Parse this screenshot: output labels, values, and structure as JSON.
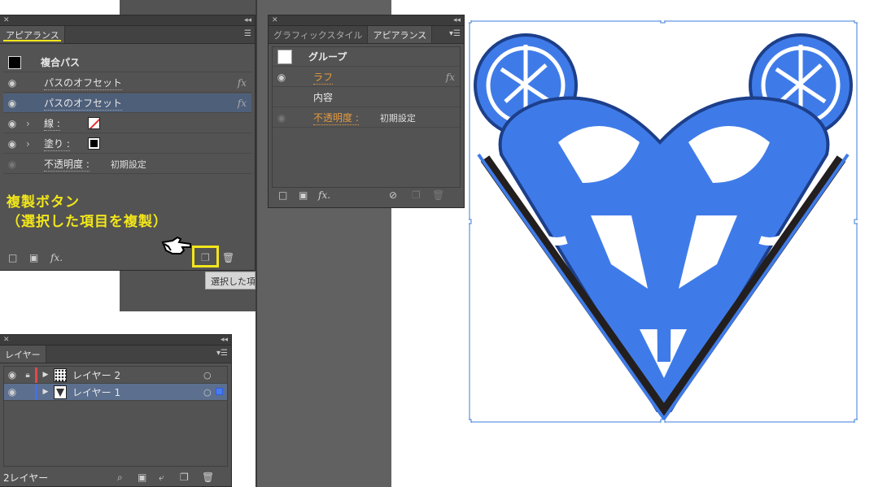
{
  "appearance_left": {
    "tab": "アピアランス",
    "header_title": "複合パス",
    "rows": [
      {
        "label": "パスのオフセット",
        "fx": "fx"
      },
      {
        "label": "パスのオフセット",
        "fx": "fx"
      },
      {
        "label": "線 :"
      },
      {
        "label": "塗り :"
      },
      {
        "label": "不透明度 :",
        "value": "初期設定"
      }
    ],
    "footer_fx": "fx."
  },
  "annotation": {
    "line1": "複製ボタン",
    "line2": "（選択した項目を複製）"
  },
  "tooltip": "選択した項",
  "appearance_right": {
    "tabs": [
      "グラフィックスタイル",
      "アピアランス"
    ],
    "header_title": "グループ",
    "rows": [
      {
        "label": "ラフ",
        "fx": "fx"
      },
      {
        "label": "内容"
      },
      {
        "label": "不透明度 :",
        "value": "初期設定"
      }
    ],
    "footer_fx": "fx."
  },
  "layers": {
    "tab": "レイヤー",
    "items": [
      {
        "name": "レイヤー 2",
        "color": "#e04a4a"
      },
      {
        "name": "レイヤー 1",
        "color": "#4a6fe0"
      }
    ],
    "count_label": "2レイヤー"
  },
  "colors": {
    "accent_yellow": "#f2e61b",
    "artwork_blue": "#3f7be8",
    "artwork_dark": "#231f1f",
    "selection": "#3b7dd8"
  },
  "icons": [
    "eye-icon",
    "lock-icon",
    "disclosure-arrow-icon",
    "new-item-icon",
    "trash-icon",
    "clear-icon",
    "layer-search-icon",
    "hand-pointer-icon"
  ]
}
